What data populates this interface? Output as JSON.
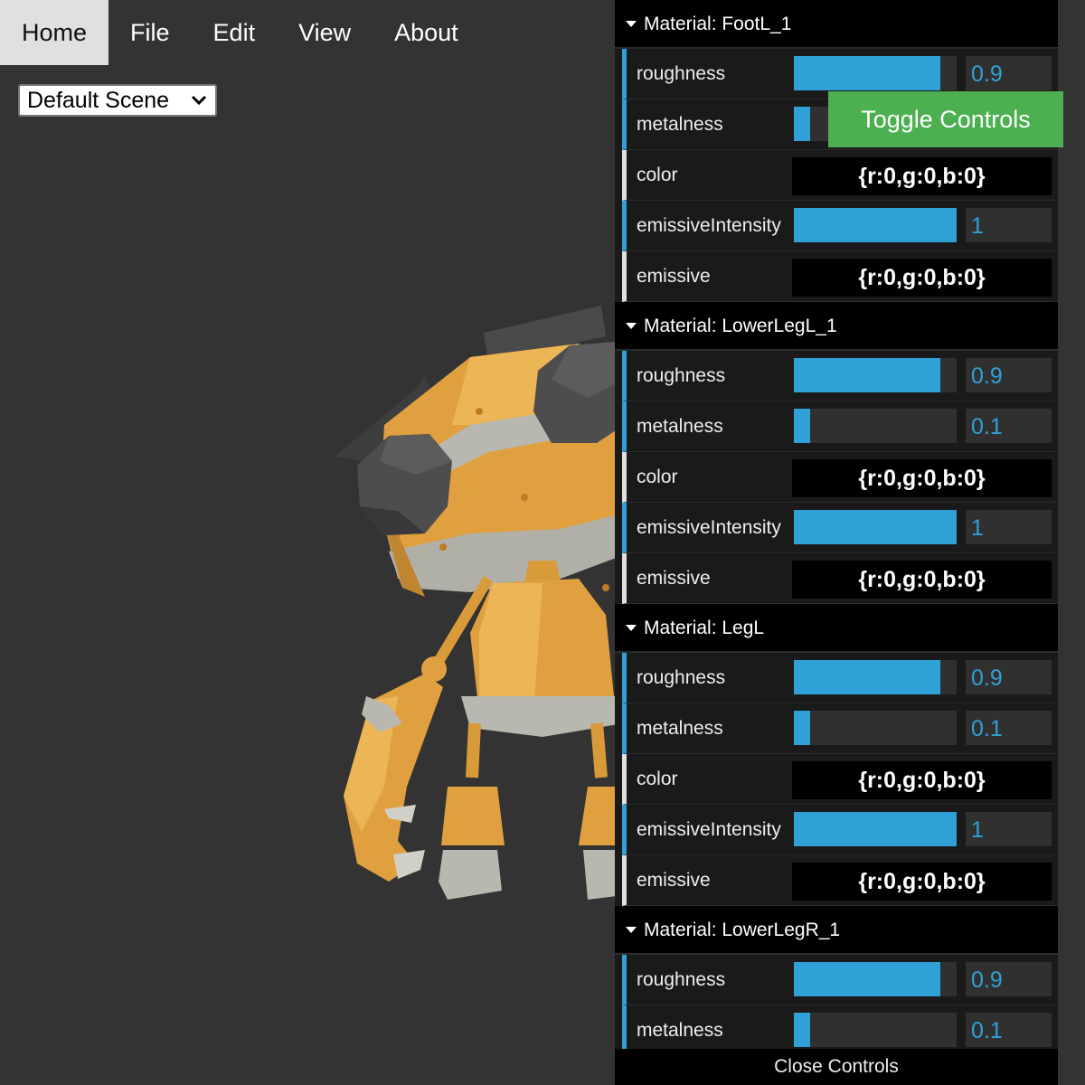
{
  "menu": {
    "items": [
      {
        "label": "Home",
        "active": true
      },
      {
        "label": "File"
      },
      {
        "label": "Edit"
      },
      {
        "label": "View"
      },
      {
        "label": "About"
      }
    ]
  },
  "scene_select": {
    "selected": "Default Scene"
  },
  "toggle_button": {
    "label": "Toggle Controls"
  },
  "close_controls": {
    "label": "Close Controls"
  },
  "gui": {
    "folders": [
      {
        "title": "Material: FootL_1",
        "rows": [
          {
            "label": "roughness",
            "type": "slider",
            "value": "0.9",
            "fraction": 0.9
          },
          {
            "label": "metalness",
            "type": "slider",
            "value": "0.1",
            "fraction": 0.1
          },
          {
            "label": "color",
            "type": "color",
            "value": "{r:0,g:0,b:0}"
          },
          {
            "label": "emissiveIntensity",
            "type": "slider",
            "value": "1",
            "fraction": 1.0
          },
          {
            "label": "emissive",
            "type": "color",
            "value": "{r:0,g:0,b:0}"
          }
        ]
      },
      {
        "title": "Material: LowerLegL_1",
        "rows": [
          {
            "label": "roughness",
            "type": "slider",
            "value": "0.9",
            "fraction": 0.9
          },
          {
            "label": "metalness",
            "type": "slider",
            "value": "0.1",
            "fraction": 0.1
          },
          {
            "label": "color",
            "type": "color",
            "value": "{r:0,g:0,b:0}"
          },
          {
            "label": "emissiveIntensity",
            "type": "slider",
            "value": "1",
            "fraction": 1.0
          },
          {
            "label": "emissive",
            "type": "color",
            "value": "{r:0,g:0,b:0}"
          }
        ]
      },
      {
        "title": "Material: LegL",
        "rows": [
          {
            "label": "roughness",
            "type": "slider",
            "value": "0.9",
            "fraction": 0.9
          },
          {
            "label": "metalness",
            "type": "slider",
            "value": "0.1",
            "fraction": 0.1
          },
          {
            "label": "color",
            "type": "color",
            "value": "{r:0,g:0,b:0}"
          },
          {
            "label": "emissiveIntensity",
            "type": "slider",
            "value": "1",
            "fraction": 1.0
          },
          {
            "label": "emissive",
            "type": "color",
            "value": "{r:0,g:0,b:0}"
          }
        ]
      },
      {
        "title": "Material: LowerLegR_1",
        "rows": [
          {
            "label": "roughness",
            "type": "slider",
            "value": "0.9",
            "fraction": 0.9
          },
          {
            "label": "metalness",
            "type": "slider",
            "value": "0.1",
            "fraction": 0.1
          }
        ]
      }
    ]
  },
  "colors": {
    "accent": "#2fa1d6",
    "toggle": "#4caf50",
    "viewport_bg": "#333333"
  }
}
